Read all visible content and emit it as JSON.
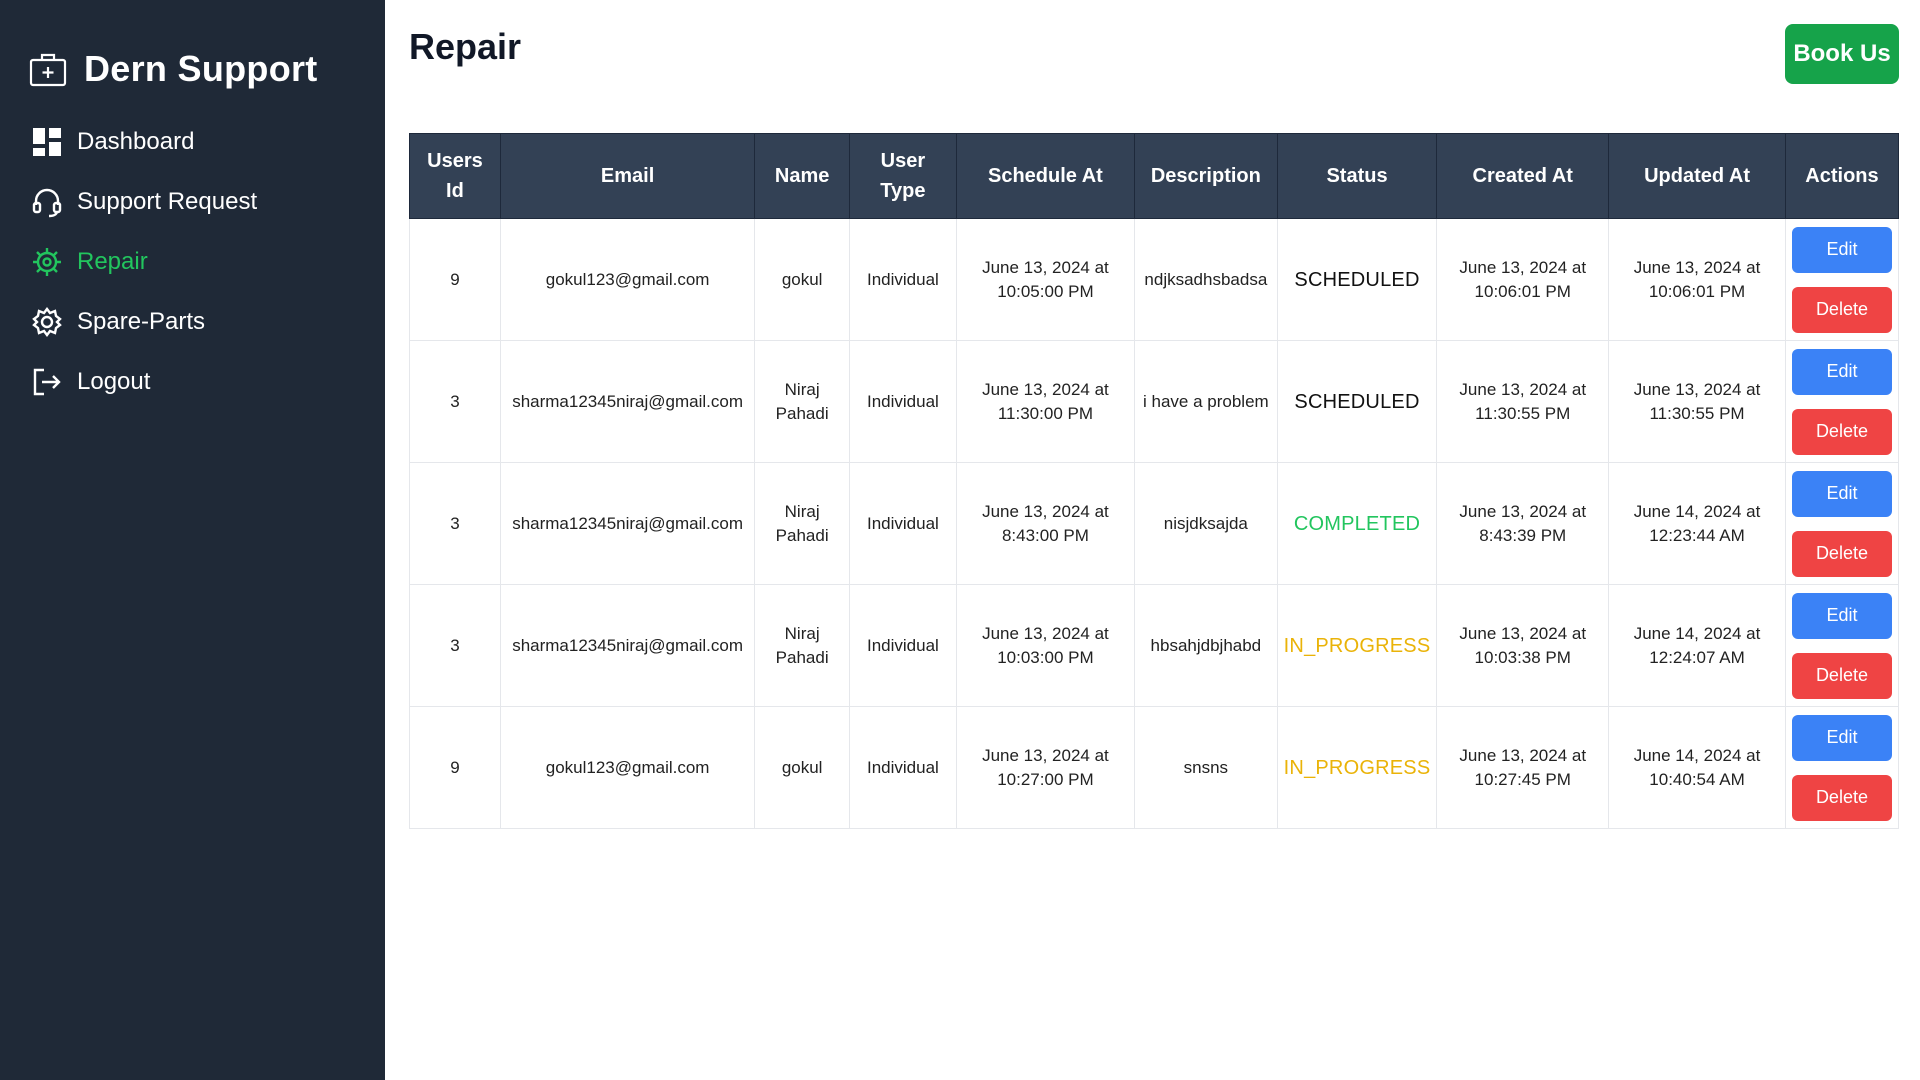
{
  "sidebar": {
    "brand": "Dern Support",
    "items": [
      {
        "label": "Dashboard",
        "icon": "dashboard-icon"
      },
      {
        "label": "Support Request",
        "icon": "headset-icon"
      },
      {
        "label": "Repair",
        "icon": "repair-gear-icon",
        "active": true
      },
      {
        "label": "Spare-Parts",
        "icon": "gear-icon"
      },
      {
        "label": "Logout",
        "icon": "logout-icon"
      }
    ]
  },
  "header": {
    "title": "Repair",
    "book_label": "Book Us"
  },
  "table": {
    "headers": [
      "Users Id",
      "Email",
      "Name",
      "User Type",
      "Schedule At",
      "Description",
      "Status",
      "Created At",
      "Updated At",
      "Actions"
    ],
    "edit_label": "Edit",
    "delete_label": "Delete",
    "rows": [
      {
        "user_id": "9",
        "email": "gokul123@gmail.com",
        "name": "gokul",
        "user_type": "Individual",
        "schedule_at": "June 13, 2024 at 10:05:00 PM",
        "description": "ndjksadhsbadsa",
        "status": "SCHEDULED",
        "created_at": "June 13, 2024 at 10:06:01 PM",
        "updated_at": "June 13, 2024 at 10:06:01 PM"
      },
      {
        "user_id": "3",
        "email": "sharma12345niraj@gmail.com",
        "name": "Niraj Pahadi",
        "user_type": "Individual",
        "schedule_at": "June 13, 2024 at 11:30:00 PM",
        "description": "i have a problem",
        "status": "SCHEDULED",
        "created_at": "June 13, 2024 at 11:30:55 PM",
        "updated_at": "June 13, 2024 at 11:30:55 PM"
      },
      {
        "user_id": "3",
        "email": "sharma12345niraj@gmail.com",
        "name": "Niraj Pahadi",
        "user_type": "Individual",
        "schedule_at": "June 13, 2024 at 8:43:00 PM",
        "description": "nisjdksajda",
        "status": "COMPLETED",
        "created_at": "June 13, 2024 at 8:43:39 PM",
        "updated_at": "June 14, 2024 at 12:23:44 AM"
      },
      {
        "user_id": "3",
        "email": "sharma12345niraj@gmail.com",
        "name": "Niraj Pahadi",
        "user_type": "Individual",
        "schedule_at": "June 13, 2024 at 10:03:00 PM",
        "description": "hbsahjdbjhabd",
        "status": "IN_PROGRESS",
        "created_at": "June 13, 2024 at 10:03:38 PM",
        "updated_at": "June 14, 2024 at 12:24:07 AM"
      },
      {
        "user_id": "9",
        "email": "gokul123@gmail.com",
        "name": "gokul",
        "user_type": "Individual",
        "schedule_at": "June 13, 2024 at 10:27:00 PM",
        "description": "snsns",
        "status": "IN_PROGRESS",
        "created_at": "June 13, 2024 at 10:27:45 PM",
        "updated_at": "June 14, 2024 at 10:40:54 AM"
      }
    ]
  },
  "colors": {
    "sidebar_bg": "#1f2937",
    "accent_green": "#22c55e",
    "header_bg": "#334155",
    "edit_blue": "#3b82f6",
    "delete_red": "#ef4444",
    "status_scheduled": "#111111",
    "status_completed": "#22c55e",
    "status_in_progress": "#eab308"
  }
}
